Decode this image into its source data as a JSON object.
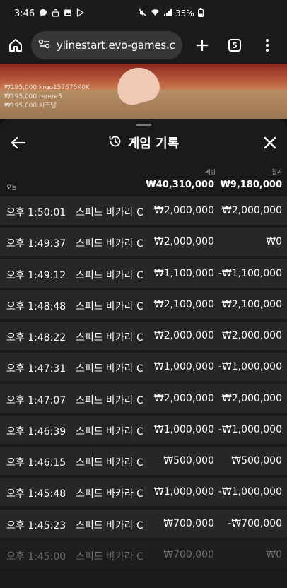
{
  "status_bar": {
    "time": "3:46",
    "indicators": "35%",
    "icons": [
      "chat-bubble-icon",
      "lock-icon",
      "image-icon",
      "play-store-icon",
      "mute-icon",
      "wifi-icon",
      "signal-icon",
      "battery-icon"
    ]
  },
  "browser": {
    "url_prefix_icon": "site-info-icon",
    "url": "ylinestart.evo-games.com",
    "tabs_count": "5"
  },
  "video": {
    "bets": [
      "₩195,000  krgo157675K0K",
      "₩195,000  rerere3",
      "₩195,000  시크남"
    ]
  },
  "panel": {
    "title": "게임 기록",
    "title_icon": "history-icon",
    "label_bet": "베팅",
    "label_result": "결과",
    "label_today": "오늘",
    "total_bet": "₩40,310,000",
    "total_result": "₩9,180,000",
    "rows": [
      {
        "time": "오후 1:50:01",
        "game": "스피드 바카라 C",
        "bet": "₩2,000,000",
        "result": "₩2,000,000"
      },
      {
        "time": "오후 1:49:37",
        "game": "스피드 바카라 C",
        "bet": "₩2,000,000",
        "result": "₩0"
      },
      {
        "time": "오후 1:49:12",
        "game": "스피드 바카라 C",
        "bet": "₩1,100,000",
        "result": "-₩1,100,000"
      },
      {
        "time": "오후 1:48:48",
        "game": "스피드 바카라 C",
        "bet": "₩2,100,000",
        "result": "₩2,100,000"
      },
      {
        "time": "오후 1:48:22",
        "game": "스피드 바카라 C",
        "bet": "₩2,000,000",
        "result": "₩2,000,000"
      },
      {
        "time": "오후 1:47:31",
        "game": "스피드 바카라 C",
        "bet": "₩1,000,000",
        "result": "-₩1,000,000"
      },
      {
        "time": "오후 1:47:07",
        "game": "스피드 바카라 C",
        "bet": "₩2,000,000",
        "result": "₩2,000,000"
      },
      {
        "time": "오후 1:46:39",
        "game": "스피드 바카라 C",
        "bet": "₩1,000,000",
        "result": "-₩1,000,000"
      },
      {
        "time": "오후 1:46:15",
        "game": "스피드 바카라 C",
        "bet": "₩500,000",
        "result": "₩500,000"
      },
      {
        "time": "오후 1:45:48",
        "game": "스피드 바카라 C",
        "bet": "₩1,000,000",
        "result": "-₩1,000,000"
      },
      {
        "time": "오후 1:45:23",
        "game": "스피드 바카라 C",
        "bet": "₩700,000",
        "result": "-₩700,000"
      },
      {
        "time": "오후 1:45:00",
        "game": "스피드 바카라 C",
        "bet": "₩700,000",
        "result": "₩0"
      }
    ]
  }
}
